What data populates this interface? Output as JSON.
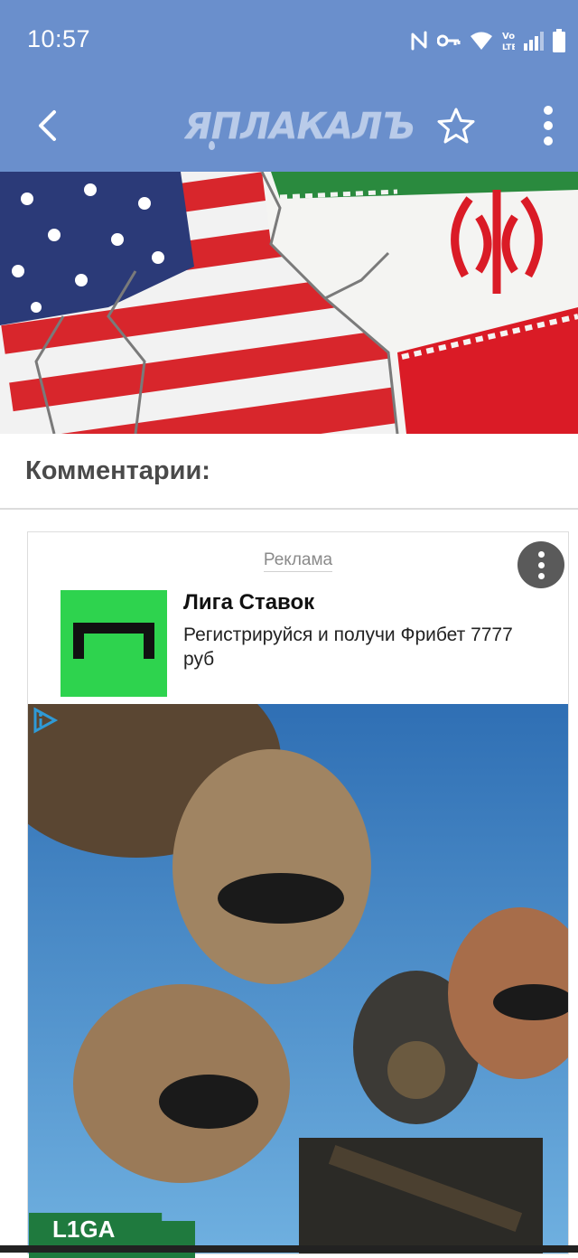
{
  "status_bar": {
    "time": "10:57",
    "icons": [
      "nfc-icon",
      "vpn-key-icon",
      "wifi-icon",
      "volte-icon",
      "signal-icon",
      "battery-icon"
    ],
    "volte_text": "Vo LTE"
  },
  "app_bar": {
    "logo_text": "ЯПЛАКАЛЪ",
    "back_icon": "back-arrow-icon",
    "favorite_icon": "star-outline-icon",
    "menu_icon": "more-vertical-icon"
  },
  "comments": {
    "title": "Комментарии:"
  },
  "ad": {
    "label": "Реклама",
    "title": "Лига Ставок",
    "text": "Регистрируйся и получи Фрибет 7777 руб",
    "badge_text": "L1GA"
  },
  "colors": {
    "app_bar": "#6a8fcc",
    "logo": "#b9cbe9",
    "ad_logo_bg": "#2ed34e"
  }
}
